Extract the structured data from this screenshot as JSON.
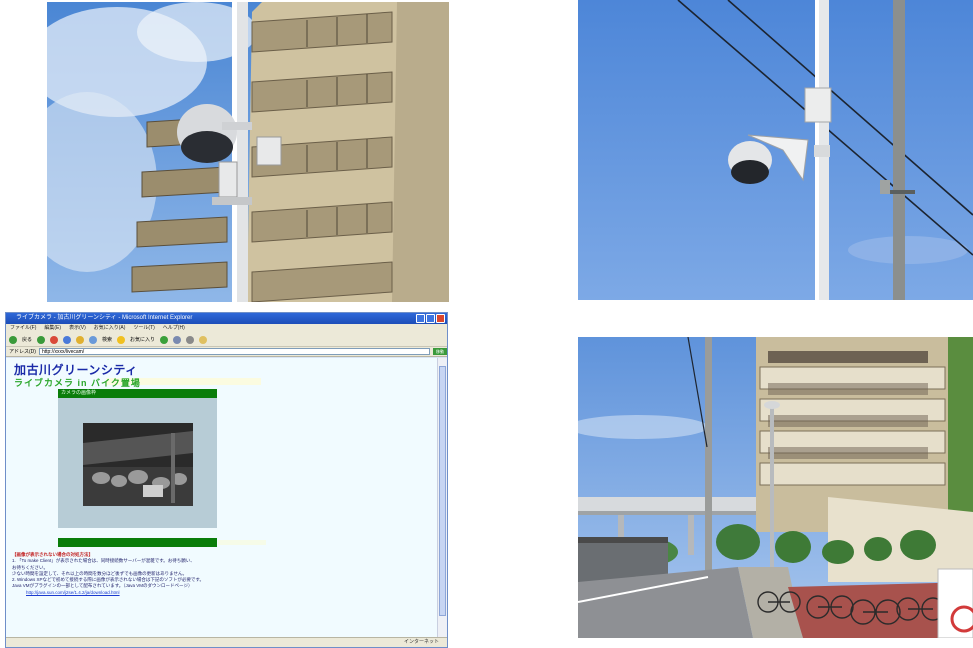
{
  "browser": {
    "window_title": "ライブカメラ - 加古川グリーンシティ - Microsoft Internet Explorer",
    "menu": [
      "ファイル(F)",
      "編集(E)",
      "表示(V)",
      "お気に入り(A)",
      "ツール(T)",
      "ヘルプ(H)"
    ],
    "toolbar": {
      "back": "戻る",
      "search": "検索",
      "favorites": "お気に入り"
    },
    "address_label": "アドレス(D)",
    "address": "http://xxxx/livecam/",
    "go_label": "移動",
    "status": "インターネット"
  },
  "site": {
    "title": "加古川グリーンシティ",
    "subtitle": "ライブカメラ in バイク置場",
    "camera_header": "カメラの画像枠"
  },
  "notes": {
    "heading": "【画像が表示されない場合の対処方法】",
    "item1": "1. 「To make Client」が表示された場合は、同時接続数サーバーが混雑です。お待ち願い、",
    "item1b": "    お待ちください。",
    "item1c": "    少ない時間を設定して、それ以上の時間を数分ほど後ずでも画像の更新はありません。",
    "item2": "2. Windows XPなどで初めて接続する際に画像が表示されない場合は下記のソフトが必要です。",
    "item2b": "    Java VMがプラグインの一部として配布されています。（Java VMのダウンロードページ）",
    "link": "http://java.sun.com/j2se/1.4.2/ja/download.html"
  },
  "colors": {
    "sky": "#5d8fd6",
    "building": "#c8bb9a",
    "page_bg": "#f1fbff",
    "green_bar": "#0a7d0a",
    "title_blue": "#1a2aa8",
    "subtitle_green": "#2aa62a"
  }
}
